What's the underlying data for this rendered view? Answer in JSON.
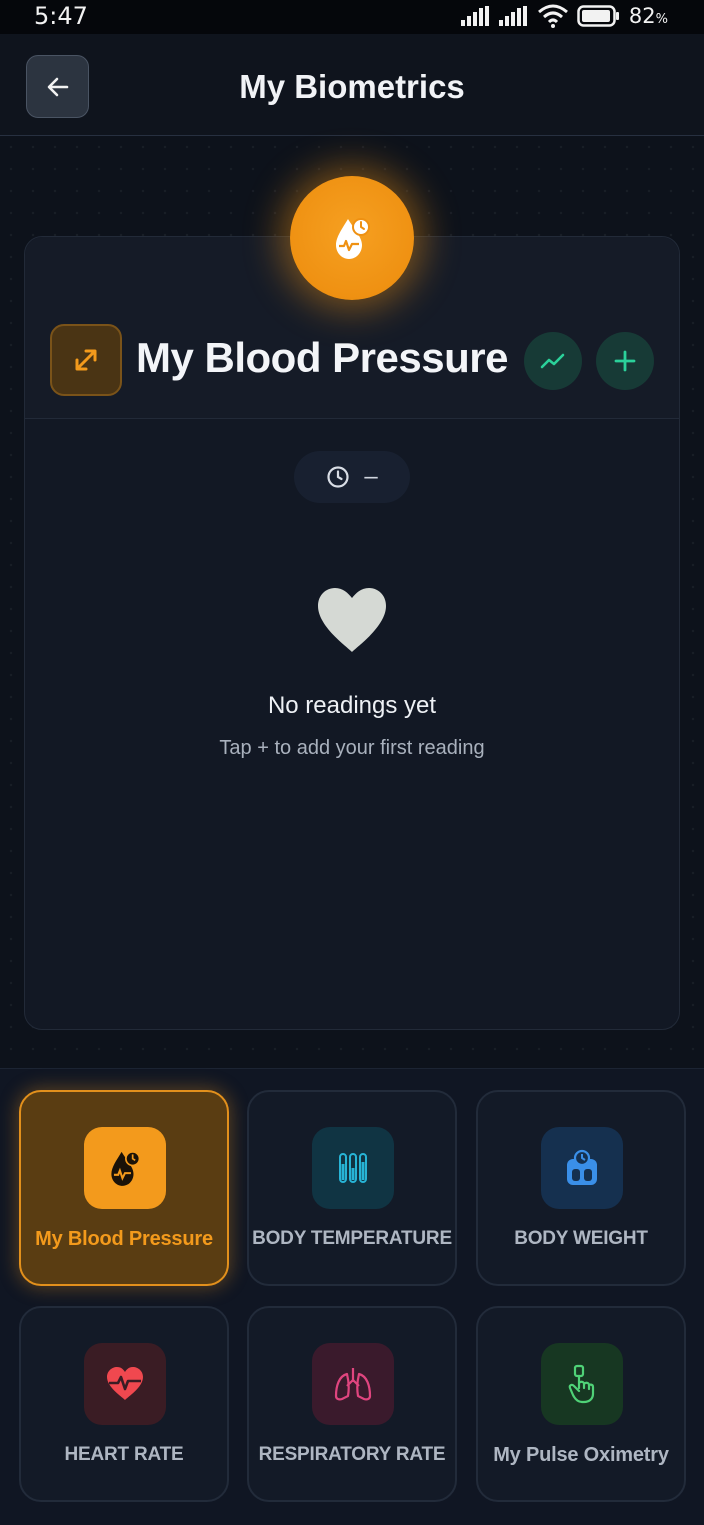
{
  "status_bar": {
    "time": "5:47",
    "battery_percent": "82",
    "battery_unit": "%"
  },
  "header": {
    "title": "My Biometrics",
    "back_icon": "arrow-left-icon"
  },
  "card": {
    "title": "My Blood Pressure",
    "hero_icon": "blood-pressure-drop-icon",
    "expand_icon": "expand-arrows-icon",
    "trend_icon": "trend-up-icon",
    "add_icon": "plus-icon",
    "time_chip": {
      "icon": "clock-icon",
      "value": "–"
    },
    "empty_state": {
      "icon": "heart-icon",
      "title": "No readings yet",
      "subtitle": "Tap + to add your first reading"
    }
  },
  "tiles": [
    {
      "label": "My Blood Pressure",
      "icon": "blood-pressure-drop-icon",
      "active": true
    },
    {
      "label": "BODY TEMPERATURE",
      "icon": "thermometer-icon",
      "active": false
    },
    {
      "label": "BODY WEIGHT",
      "icon": "scale-icon",
      "active": false
    },
    {
      "label": "HEART RATE",
      "icon": "heart-pulse-icon",
      "active": false
    },
    {
      "label": "RESPIRATORY RATE",
      "icon": "lungs-icon",
      "active": false
    },
    {
      "label": "My Pulse Oximetry",
      "icon": "finger-oximeter-icon",
      "active": false
    }
  ],
  "colors": {
    "accent_orange": "#f0921a",
    "background": "#0b1019",
    "teal": "#2bd19a",
    "temperature_cyan": "#27b4d6",
    "weight_blue": "#3a8fe8",
    "heart_red": "#f0484f",
    "lungs_pink": "#e0457f",
    "oximetry_green": "#4fd277"
  }
}
